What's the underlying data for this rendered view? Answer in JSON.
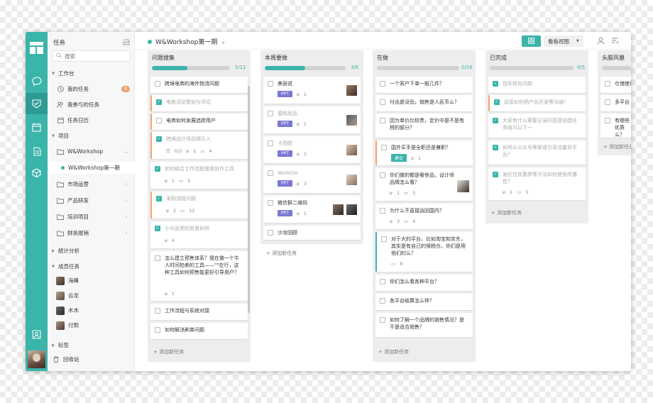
{
  "sidebar": {
    "title": "任务",
    "search_placeholder": "搜索",
    "workspace_label": "工作台",
    "my_tasks": "我的任务",
    "my_tasks_badge": "4",
    "involved_tasks": "我参与的任务",
    "task_calendar": "任务日历",
    "projects_label": "项目",
    "project_group": "W&Workshop",
    "project_current": "W&Workshop第一期",
    "folders": [
      "市场运营",
      "产品研发",
      "培训项目",
      "财务报销"
    ],
    "stats_label": "统计分析",
    "members_label": "成员任务",
    "members": [
      "海峰",
      "云龙",
      "木木",
      "付熙"
    ],
    "tags_label": "标签",
    "trash_label": "回收站"
  },
  "topbar": {
    "project_title": "W&Workshop第一期",
    "view_label": "看板视图"
  },
  "columns": [
    {
      "name": "问题搜集",
      "count": "5/11",
      "progress": 0.45,
      "cards": [
        {
          "title": "跨境电商的海外物流问题",
          "done": false
        },
        {
          "title": "电商活动策划与评估",
          "done": true
        },
        {
          "title": "电商如何发展追踪用户",
          "done": false
        },
        {
          "title": "跨境设计师品牌引入",
          "done": true,
          "meta": [
            "0/3",
            "1",
            "4"
          ]
        },
        {
          "title": "如何结合工作流程使用协作工具",
          "done": true,
          "meta": [
            "1",
            "5"
          ]
        },
        {
          "title": "采购流程问题",
          "done": true,
          "meta": [
            "2",
            "12"
          ]
        },
        {
          "title": "小众品类的前景如何",
          "done": true,
          "meta": [
            "4"
          ]
        },
        {
          "title": "怎么建立预售体系？我在做一个牛人时间拍卖的工具——\"\"在行，这种工具如何预售能更好引导用户？",
          "done": false,
          "meta": [
            "1"
          ]
        },
        {
          "title": "工作流程与系统对接",
          "done": false
        },
        {
          "title": "如何解决刷单问题",
          "done": false
        }
      ],
      "add_label": "添加新任务"
    },
    {
      "name": "本周要做",
      "count": "3/6",
      "progress": 0.5,
      "cards": [
        {
          "title": "美丽说",
          "done": false,
          "tag": "PPT",
          "meta": [
            "1"
          ]
        },
        {
          "title": "蜜桃尚品",
          "done": false,
          "tag": "PPT",
          "meta": [
            "1"
          ]
        },
        {
          "title": "卡西欧",
          "done": false,
          "tag": "PPT",
          "meta": [
            "1"
          ]
        },
        {
          "title": "Worktile",
          "done": false,
          "tag": "PPT",
          "meta": [
            "3"
          ]
        },
        {
          "title": "微信群二维码",
          "done": false,
          "tag": "PPT",
          "meta": [
            "1"
          ]
        },
        {
          "title": "沙龙回顾",
          "done": false
        }
      ],
      "add_label": "添加新任务"
    },
    {
      "name": "在做",
      "count": "0/16",
      "progress": 0.0,
      "cards": [
        {
          "title": "一个客户下单一般几件？",
          "done": false
        },
        {
          "title": "付出是没劲，销售是人民币么？",
          "done": false
        },
        {
          "title": "因为单价比较贵，定价中是不是有税的部分？",
          "done": false
        },
        {
          "title": "国外买手是全职还是兼职？",
          "done": false,
          "tag": "建议",
          "meta": [
            "1"
          ]
        },
        {
          "title": "你们做的都是奢侈品，设计师品牌怎么看？",
          "done": false,
          "meta": [
            "1",
            "5"
          ]
        },
        {
          "title": "为什么不直接运回国内？",
          "done": false,
          "meta": [
            "3",
            "4"
          ]
        },
        {
          "title": "对于大的平台，比如淘宝和京东，其实是有自己的保税仓。你们是用他们的么？",
          "done": false,
          "meta": [
            "8"
          ]
        },
        {
          "title": "你们怎么看各种平台？",
          "done": false
        },
        {
          "title": "各平台结算怎么样？",
          "done": false
        },
        {
          "title": "如何了解一个品牌的销售情况？是不是适合销售？",
          "done": false
        }
      ],
      "add_label": "添加新任务"
    },
    {
      "name": "已完成",
      "count": "0/5",
      "progress": 0.0,
      "cards": [
        {
          "title": "加车转化问题",
          "done": true
        },
        {
          "title": "运营如何把产品开发等沟通？",
          "done": true
        },
        {
          "title": "大家有什么需要记录的直接创建任务就可以了～",
          "done": true
        },
        {
          "title": "如何从公众号等渠道引导流量到平台？",
          "done": true
        },
        {
          "title": "发红包优惠券等方法如何使用传播性？",
          "done": true,
          "meta": [
            "1",
            "5"
          ]
        }
      ],
      "add_label": "添加新任务"
    },
    {
      "name": "头脑风暴",
      "count": "",
      "progress": 0.0,
      "cards": [
        {
          "title": "仓储使用",
          "done": false
        },
        {
          "title": "多平台",
          "done": false
        },
        {
          "title": "有哪些优质么？",
          "done": false
        }
      ],
      "add_label": "添加新任务"
    }
  ],
  "colors": {
    "accent": "#3bb4aa",
    "orange": "#f0a470",
    "tag_purple": "#7b77d3"
  }
}
